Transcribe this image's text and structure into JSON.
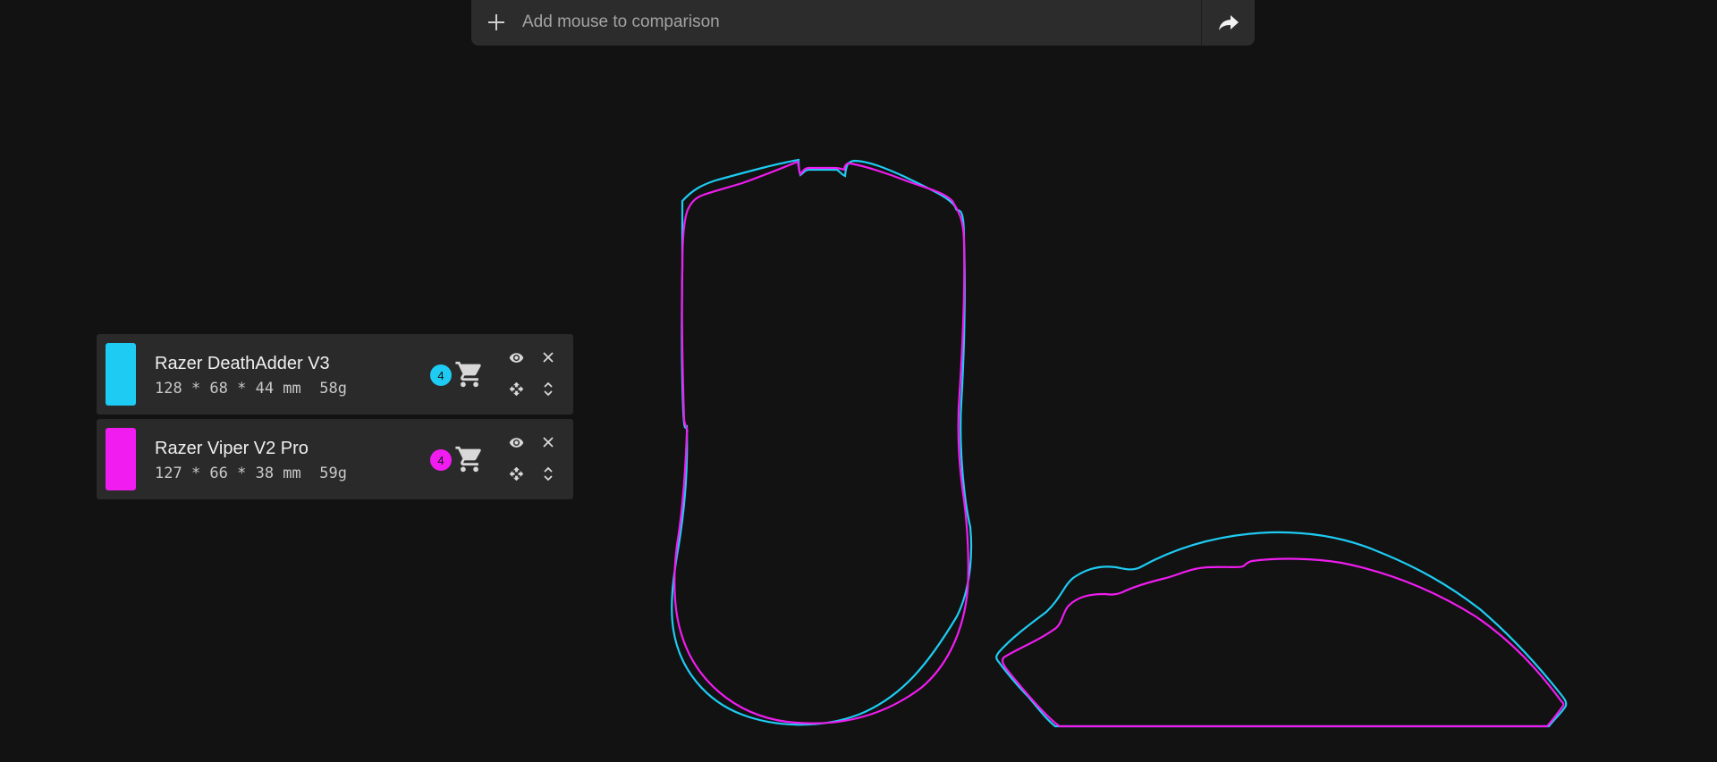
{
  "search": {
    "placeholder": "Add mouse to comparison"
  },
  "icons": {
    "add": "plus-icon",
    "share": "share-arrow-icon",
    "visibility": "eye-icon",
    "remove": "close-icon",
    "move": "move-arrows-icon",
    "reorder": "unfold-chevrons-icon",
    "shop": "shopping-cart-icon"
  },
  "colors": {
    "background": "#121212",
    "panel": "#2a2a2a",
    "death_adder": "#1ecbf2",
    "viper": "#f01cf0"
  },
  "mice": [
    {
      "name": "Razer DeathAdder V3",
      "specs": "128 * 68 * 44 mm  58g",
      "shop_count": "4",
      "color": "#1ecbf2"
    },
    {
      "name": "Razer Viper V2 Pro",
      "specs": "127 * 66 * 38 mm  59g",
      "shop_count": "4",
      "color": "#f01cf0"
    }
  ]
}
